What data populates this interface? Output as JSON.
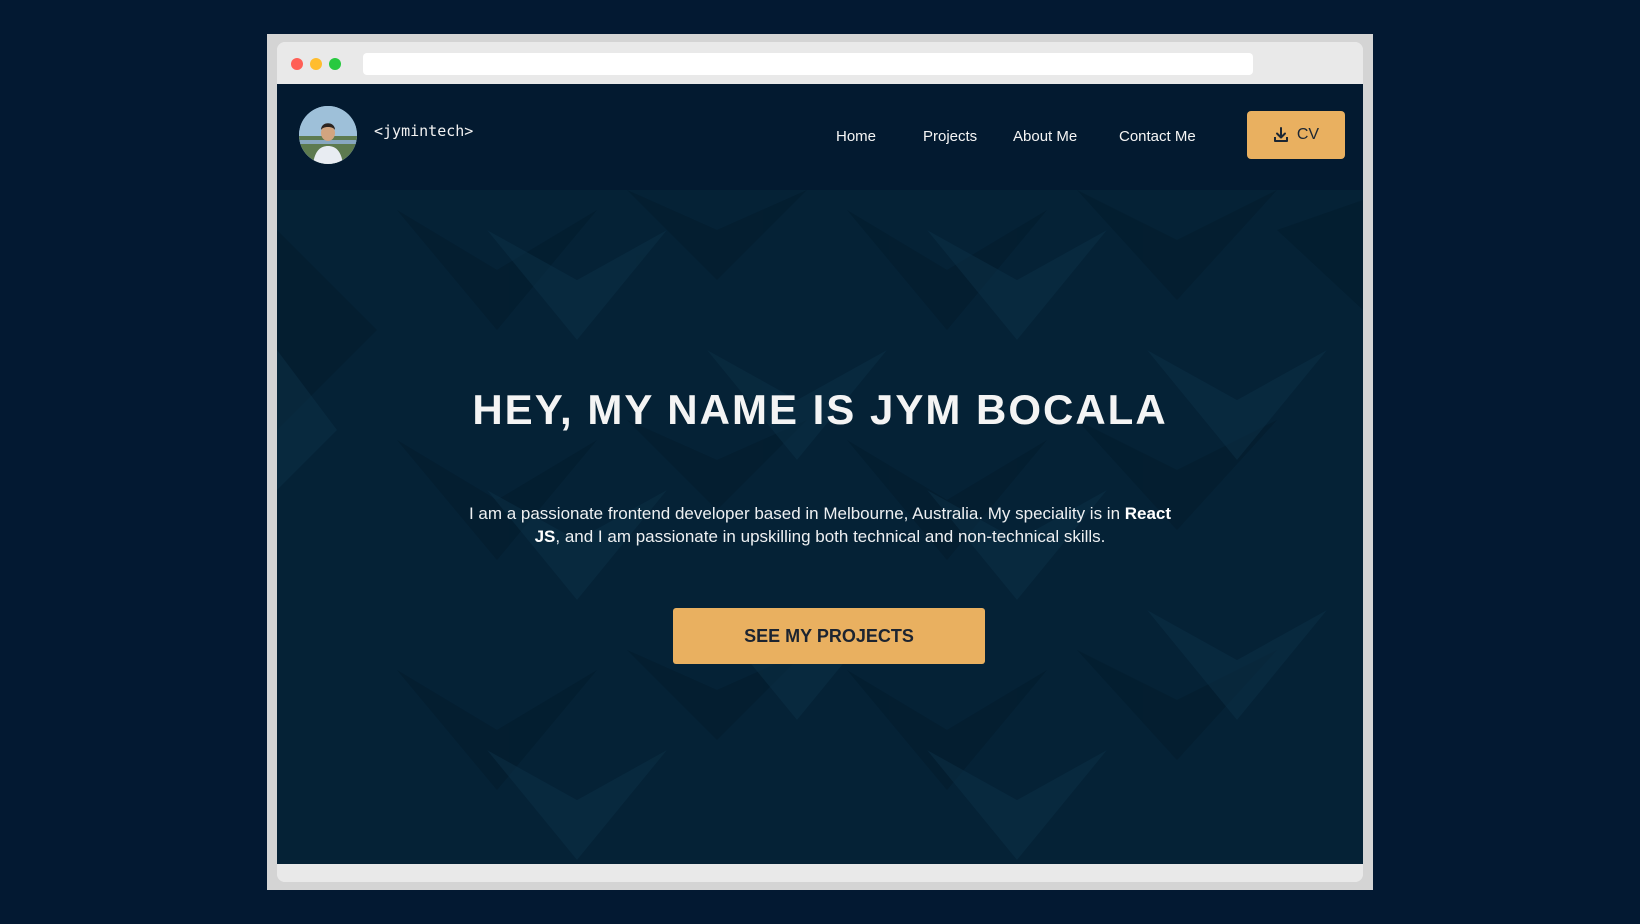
{
  "browser": {
    "url": ""
  },
  "navbar": {
    "brand": "<jymintech>",
    "links": [
      "Home",
      "Projects",
      "About Me",
      "Contact Me"
    ],
    "cv_label": "CV"
  },
  "hero": {
    "title": "HEY, MY NAME IS JYM BOCALA",
    "text_before": "I am a passionate frontend developer based in Melbourne, Australia. My speciality is in ",
    "text_bold": "React JS",
    "text_after": ", and I am passionate in upskilling both technical and non-technical skills.",
    "cta_label": "SEE MY PROJECTS"
  },
  "icons": {
    "cv": "download-icon"
  },
  "colors": {
    "outer_background": "#031932",
    "navbar": "#031a30",
    "hero": "#052236",
    "accent": "#e9b060"
  }
}
